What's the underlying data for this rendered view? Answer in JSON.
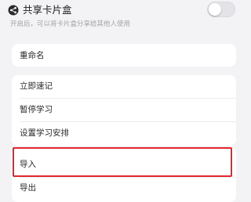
{
  "share": {
    "title": "共享卡片盒",
    "description": "开启后，可以将卡片盒分享给其他人使用",
    "toggle_on": false
  },
  "menu": {
    "rename": "重命名",
    "quick_record": "立即速记",
    "pause_study": "暂停学习",
    "study_schedule": "设置学习安排",
    "import": "导入",
    "export": "导出"
  },
  "highlight": {
    "color": "#e3262e"
  }
}
